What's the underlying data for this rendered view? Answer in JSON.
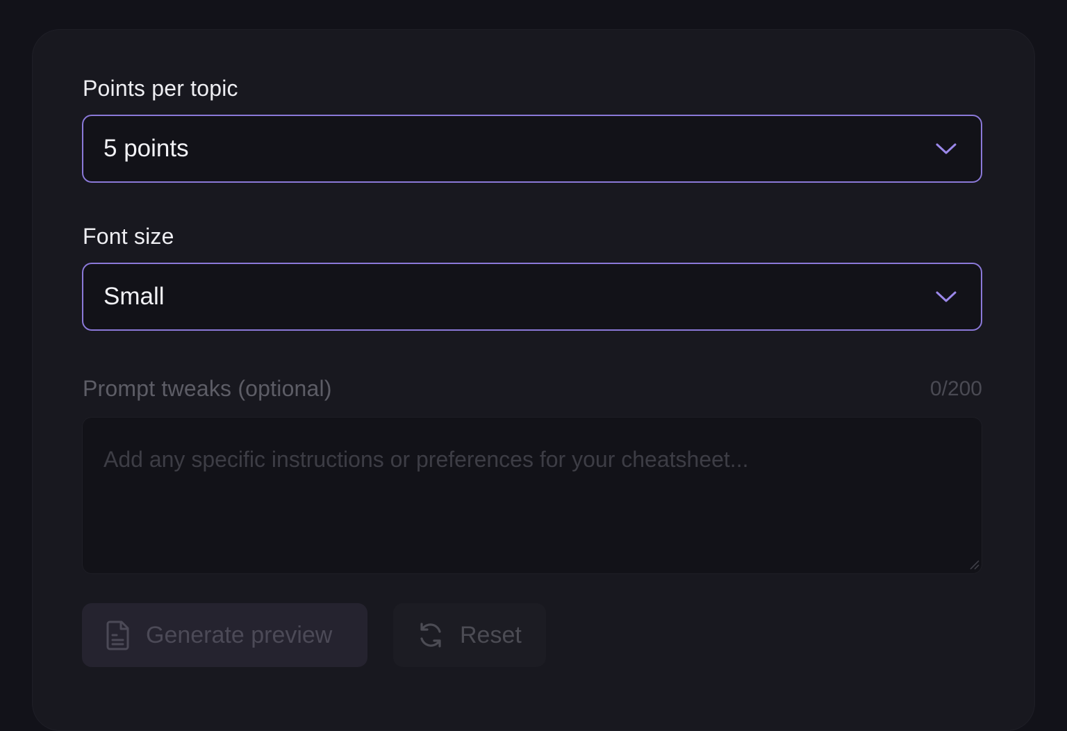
{
  "points_per_topic": {
    "label": "Points per topic",
    "selected": "5 points"
  },
  "font_size": {
    "label": "Font size",
    "selected": "Small"
  },
  "prompt_tweaks": {
    "label": "Prompt tweaks (optional)",
    "counter": "0/200",
    "placeholder": "Add any specific instructions or preferences for your cheatsheet...",
    "value": ""
  },
  "actions": {
    "generate_label": "Generate preview",
    "reset_label": "Reset"
  },
  "colors": {
    "accent_border": "#8b79d9",
    "background": "#121219",
    "card": "#18181f"
  },
  "icons": {
    "select_chevron": "chevron-down-icon",
    "generate": "document-icon",
    "reset": "refresh-icon"
  }
}
